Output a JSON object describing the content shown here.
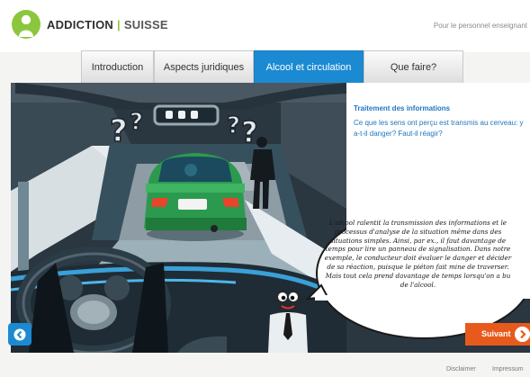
{
  "brand": {
    "name_part1": "ADDICTION",
    "separator": "|",
    "name_part2": "SUISSE",
    "accent": "#8cc63e"
  },
  "header": {
    "audience_link": "Pour le personnel enseignant"
  },
  "tabs": [
    {
      "label": "Introduction",
      "active": false
    },
    {
      "label": "Aspects juridiques",
      "active": false
    },
    {
      "label": "Alcool et circulation",
      "active": true
    },
    {
      "label": "Que faire?",
      "active": false
    }
  ],
  "panel": {
    "title": "Traitement des informations",
    "text": "Ce que les sens ont perçu est transmis au cerveau: y a-t-il danger? Faut-il réagir?"
  },
  "speech_bubble": {
    "text": "L'alcool ralentit la transmission des informations et le processus d'analyse de la situation même dans des situations simples. Ainsi, par ex., il faut davantage de temps pour lire un panneau de signalisation. Dans notre exemple, le conducteur doit évaluer le danger et décider de sa réaction, puisque le piéton fait mine de traverser. Mais tout cela prend davantage de temps lorsqu'on a bu de l'alcool."
  },
  "nav": {
    "back_icon": "arrow-left-icon",
    "next_label": "Suivant",
    "next_icon": "arrow-right-icon"
  },
  "footer": {
    "disclaimer": "Disclaimer",
    "impressum": "Impressum"
  },
  "colors": {
    "active_tab": "#1c8ad2",
    "next_button": "#e85a1c",
    "panel_text": "#1f77c0"
  }
}
